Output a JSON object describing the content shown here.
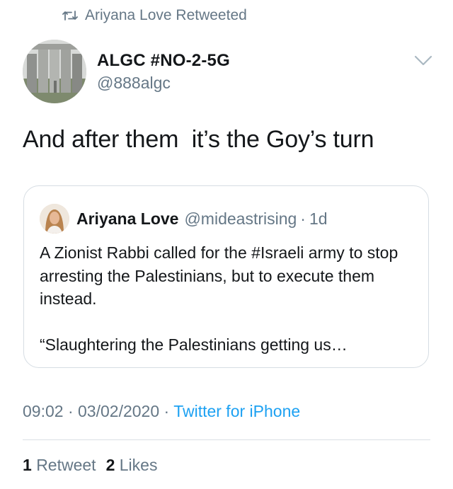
{
  "retweet_banner": {
    "icon": "retweet-icon",
    "text": "Ariyana Love Retweeted"
  },
  "tweet": {
    "author_name": "ALGC #NO-2-5G",
    "author_handle": "@888algc",
    "text": "And after them  it’s the Goy’s turn",
    "menu_icon": "chevron-down-icon",
    "time": "09:02",
    "date": "03/02/2020",
    "source": "Twitter for iPhone",
    "separator": "·"
  },
  "quoted_tweet": {
    "author_name": "Ariyana Love",
    "author_handle": "@mideastrising",
    "separator": "·",
    "age": "1d",
    "paragraphs": [
      "A Zionist Rabbi called for the #Israeli army to stop arresting the Palestinians, but to execute them instead.",
      "“Slaughtering the Palestinians getting us…"
    ]
  },
  "stats": {
    "retweets_count": "1",
    "retweets_label": "Retweet",
    "likes_count": "2",
    "likes_label": "Likes"
  },
  "colors": {
    "secondary_text": "#657786",
    "link": "#1da1f2",
    "border": "#d6dde3",
    "primary_text": "#14171a"
  }
}
